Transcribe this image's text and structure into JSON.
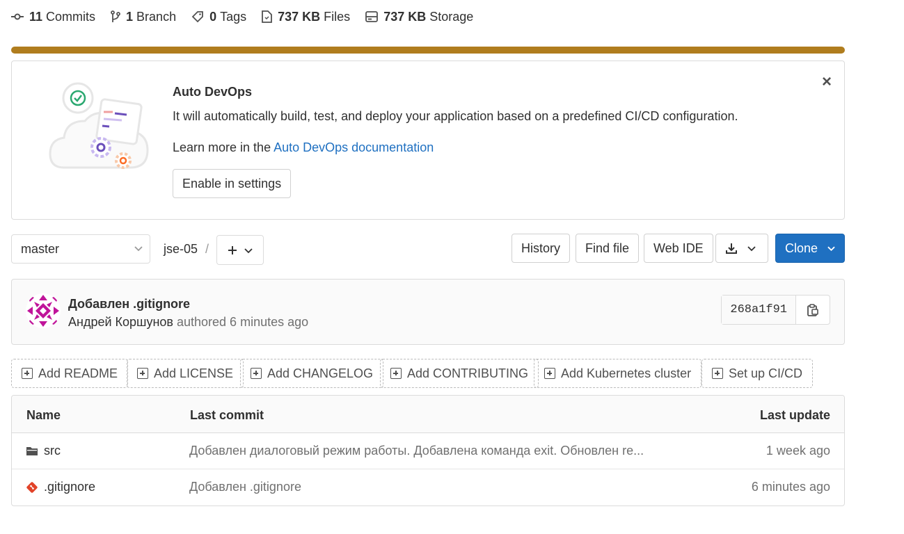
{
  "stats": {
    "commits_count": "11",
    "commits_label": "Commits",
    "branch_count": "1",
    "branch_label": "Branch",
    "tags_count": "0",
    "tags_label": "Tags",
    "files_size": "737 KB",
    "files_label": "Files",
    "storage_size": "737 KB",
    "storage_label": "Storage"
  },
  "colors": {
    "accent": "#b07d1e",
    "link": "#1f70c1",
    "clone_button": "#1f70c1",
    "gitignore_icon": "#e24329"
  },
  "banner": {
    "title": "Auto DevOps",
    "description": "It will automatically build, test, and deploy your application based on a predefined CI/CD configuration.",
    "learn_prefix": "Learn more in the ",
    "learn_link": "Auto DevOps documentation",
    "enable_button": "Enable in settings",
    "close_icon": "close-icon"
  },
  "nav": {
    "branch": "master",
    "breadcrumb": "jse-05",
    "separator": "/",
    "history": "History",
    "find_file": "Find file",
    "web_ide": "Web IDE",
    "clone": "Clone"
  },
  "commit": {
    "title": "Добавлен .gitignore",
    "author": "Андрей Коршунов",
    "authored": " authored 6 minutes ago",
    "sha": "268a1f91"
  },
  "quick_actions": [
    "Add README",
    "Add LICENSE",
    "Add CHANGELOG",
    "Add CONTRIBUTING",
    "Add Kubernetes cluster",
    "Set up CI/CD"
  ],
  "table": {
    "headers": {
      "name": "Name",
      "last_commit": "Last commit",
      "last_update": "Last update"
    },
    "rows": [
      {
        "name": "src",
        "icon": "folder-icon",
        "message": "Добавлен диалоговый режим работы. Добавлена команда exit. Обновлен re...",
        "updated": "1 week ago"
      },
      {
        "name": ".gitignore",
        "icon": "git-icon",
        "message": "Добавлен .gitignore",
        "updated": "6 minutes ago"
      }
    ]
  }
}
